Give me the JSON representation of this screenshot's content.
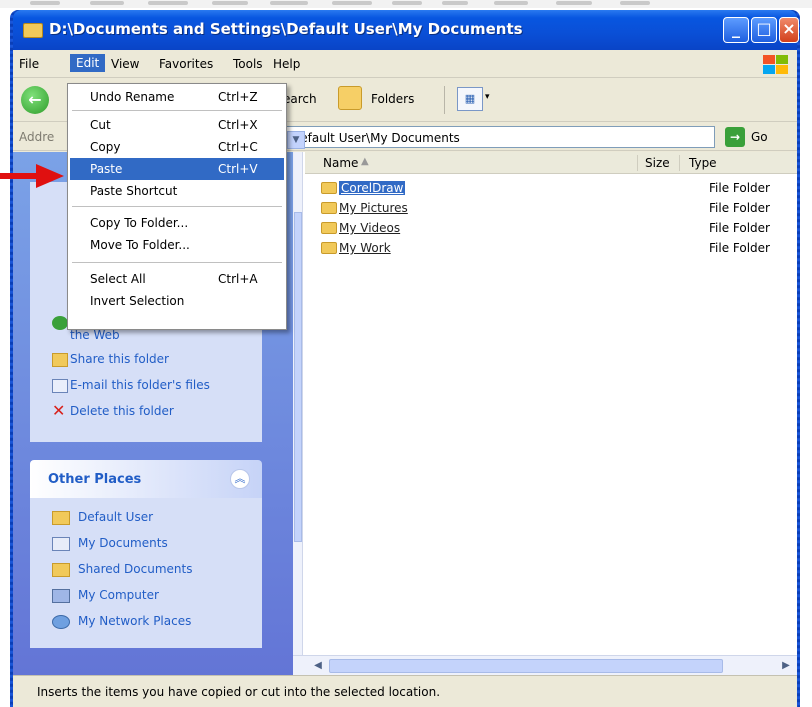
{
  "window": {
    "title": "D:\\Documents and Settings\\Default User\\My Documents"
  },
  "menubar": {
    "items": [
      "File",
      "Edit",
      "View",
      "Favorites",
      "Tools",
      "Help"
    ]
  },
  "toolbar": {
    "back_label": "Back",
    "search_label": "earch",
    "folders_label": "Folders"
  },
  "addressbar": {
    "label": "Addre",
    "path": "\\Default User\\My Documents",
    "go_label": "Go"
  },
  "edit_menu": {
    "items": [
      {
        "label": "Undo Rename",
        "shortcut": "Ctrl+Z"
      },
      {
        "label": "Cut",
        "shortcut": "Ctrl+X"
      },
      {
        "label": "Copy",
        "shortcut": "Ctrl+C"
      },
      {
        "label": "Paste",
        "shortcut": "Ctrl+V"
      },
      {
        "label": "Paste Shortcut",
        "shortcut": ""
      },
      {
        "label": "Copy To Folder...",
        "shortcut": ""
      },
      {
        "label": "Move To Folder...",
        "shortcut": ""
      },
      {
        "label": "Select All",
        "shortcut": "Ctrl+A"
      },
      {
        "label": "Invert Selection",
        "shortcut": ""
      }
    ],
    "highlighted": "Paste"
  },
  "tasks": {
    "items": [
      "the Web",
      "Share this folder",
      "E-mail this folder's files",
      "Delete this folder"
    ]
  },
  "other_places": {
    "title": "Other Places",
    "items": [
      "Default User",
      "My Documents",
      "Shared Documents",
      "My Computer",
      "My Network Places"
    ]
  },
  "file_list": {
    "columns": {
      "name": "Name",
      "size": "Size",
      "type": "Type"
    },
    "rows": [
      {
        "name": "CorelDraw",
        "type": "File Folder",
        "selected": true
      },
      {
        "name": "My Pictures",
        "type": "File Folder",
        "selected": false
      },
      {
        "name": "My Videos",
        "type": "File Folder",
        "selected": false
      },
      {
        "name": "My Work",
        "type": "File Folder",
        "selected": false
      }
    ]
  },
  "statusbar": {
    "text": "Inserts the items you have copied or cut into the selected location."
  },
  "colors": {
    "title_blue": "#0a4fd6",
    "selection": "#316ac5",
    "pointer_arrow": "#e01010",
    "link_blue": "#215dc6"
  }
}
